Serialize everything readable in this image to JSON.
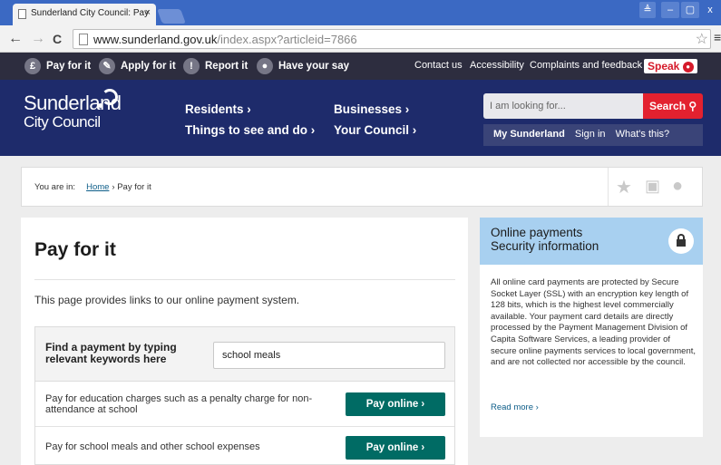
{
  "browser": {
    "tab_title": "Sunderland City Council: Pay",
    "tab_close": "×",
    "url_host": "www.sunderland.gov.uk",
    "url_path": "/index.aspx?articleid=7866",
    "win_user": "≜",
    "win_min": "–",
    "win_max": "▢",
    "win_close": "x",
    "back": "←",
    "forward": "→",
    "reload": "C",
    "menu": "≡",
    "star": "☆"
  },
  "utility": {
    "items": [
      {
        "icon": "£",
        "label": "Pay for it"
      },
      {
        "icon": "✎",
        "label": "Apply for it"
      },
      {
        "icon": "!",
        "label": "Report it"
      },
      {
        "icon": "●",
        "label": "Have your say"
      }
    ],
    "links": [
      "Contact us",
      "Accessibility",
      "Complaints and feedback"
    ],
    "speak": "Speak"
  },
  "header": {
    "logo_line1": "Sunderland",
    "logo_line2": "City Council",
    "nav": [
      "Residents ›",
      "Businesses ›",
      "Things to see and do ›",
      "Your Council ›"
    ],
    "search_placeholder": "I am looking for...",
    "search_button": "Search",
    "my_sunderland": "My Sunderland",
    "sign_in": "Sign in",
    "whats_this": "What's this?"
  },
  "breadcrumb": {
    "prefix": "You are in:",
    "home": "Home",
    "current": "› Pay for it"
  },
  "main": {
    "title": "Pay for it",
    "intro": "This page provides links to our online payment system.",
    "find_label": "Find a payment by typing relevant keywords here",
    "find_value": "school meals",
    "rows": [
      {
        "text": "Pay for education charges such as a penalty charge for non-attendance at school",
        "button": "Pay online ›"
      },
      {
        "text": "Pay for school meals and other school expenses",
        "button": "Pay online ›"
      }
    ]
  },
  "sidebar": {
    "title_line1": "Online payments",
    "title_line2": "Security information",
    "body": "All online card payments are protected by Secure Socket Layer (SSL) with an encryption key length of 128 bits, which is the highest level commercially available. Your payment card details are directly processed by the Payment Management Division of Capita Software Services, a leading provider of secure online payments services to local government, and are not collected nor accessible by the council.",
    "read_more": "Read more ›"
  },
  "colors": {
    "tabstrip": "#3b69c3",
    "utilbar": "#2d2d3f",
    "header": "#1e2b6b",
    "search": "#e3212f",
    "pay_button": "#006b64",
    "sidebar_head": "#a8d0f0"
  }
}
